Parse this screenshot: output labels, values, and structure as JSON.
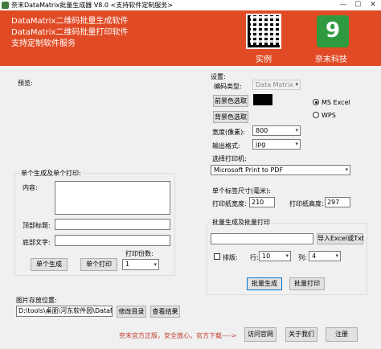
{
  "window": {
    "title": "奈末DataMatrix批量生成器 V8.0 <支持软件定制服务>",
    "minimize": "—",
    "maximize": "☐",
    "close": "✕"
  },
  "banner": {
    "line1": "DataMatrix二维码批量生成软件",
    "line2": "DataMatrix二维码批量打印软件",
    "line3": "支持定制软件服务",
    "sample_caption": "实例",
    "brand_logo": "9",
    "brand_caption": "奈末科技",
    "bg_color": "#e04b25",
    "logo_color": "#2f9a3f"
  },
  "preview": {
    "label": "预览:"
  },
  "single": {
    "group_title": "单个生成及单个打印:",
    "content_label": "内容:",
    "content_value": "",
    "top_label": "顶部标题:",
    "top_value": "",
    "bottom_label": "底部文字:",
    "bottom_value": "",
    "print_copies_label": "打印份数:",
    "print_copies_value": "1",
    "generate_button": "单个生成",
    "print_button": "单个打印"
  },
  "storage": {
    "label": "图片存放位置:",
    "path_value": "D:\\tools\\桌面\\河东软件园\\DataMa",
    "modify_button": "修改目录",
    "view_button": "查看结果"
  },
  "settings": {
    "title": "设置:",
    "encoding_label": "编码类型:",
    "encoding_value": "Data Matrix",
    "fg_button": "前景色选取",
    "bg_button": "背景色选取",
    "fg_color": "#000000",
    "radio_ms_excel": "MS Excel",
    "radio_wps": "WPS",
    "width_label": "宽度(像素):",
    "width_value": "800",
    "format_label": "输出格式:",
    "format_value": "jpg",
    "printer_label": "选择打印机:",
    "printer_value": "Microsoft Print to PDF",
    "label_size_label": "单个标签尺寸(毫米):",
    "print_width_label": "打印纸宽度:",
    "print_width_value": "210",
    "print_height_label": "打印纸高度:",
    "print_height_value": "297"
  },
  "batch": {
    "group_title": "批量生成及批量打印",
    "import_button": "导入Excel或Txt",
    "file_value": "",
    "arrange_label": "排版:",
    "row_label": "行:",
    "row_value": "10",
    "col_label": "列:",
    "col_value": "4",
    "generate_button": "批量生成",
    "print_button": "批量打印"
  },
  "footer": {
    "notice": "奈末官方正版，安全放心，官方下载---->",
    "visit_button": "访问官网",
    "about_button": "关于我们",
    "register_button": "注册",
    "notice_color": "#c0392b"
  }
}
